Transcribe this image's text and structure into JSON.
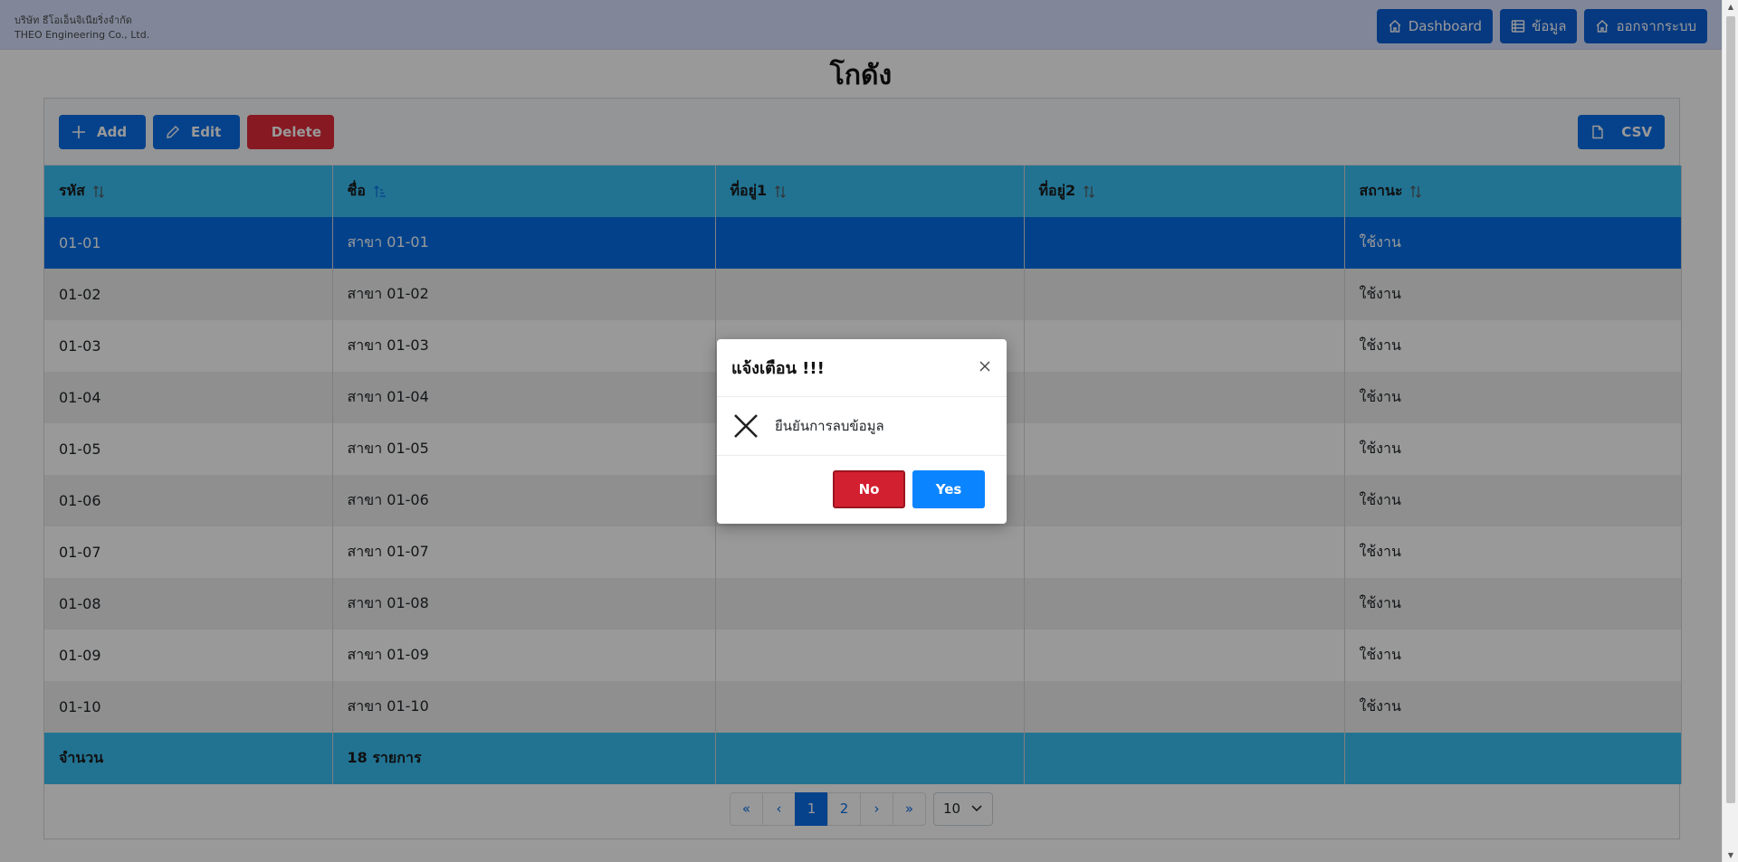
{
  "header": {
    "company_th": "บริษัท ธีโอเอ็นจิเนียริ่งจำกัด",
    "company_en": "THEO Engineering Co., Ltd.",
    "nav": [
      {
        "label": "Dashboard",
        "icon": "home-icon"
      },
      {
        "label": "ข้อมูล",
        "icon": "list-icon"
      },
      {
        "label": "ออกจากระบบ",
        "icon": "home-icon"
      }
    ]
  },
  "page": {
    "title": "โกดัง"
  },
  "toolbar": {
    "add_label": "Add",
    "edit_label": "Edit",
    "delete_label": "Delete",
    "csv_label": "CSV"
  },
  "table": {
    "columns": [
      "รหัส",
      "ชื่อ",
      "ที่อยู่1",
      "ที่อยู่2",
      "สถานะ"
    ],
    "rows": [
      {
        "code": "01-01",
        "name": "สาขา 01-01",
        "addr1": "",
        "addr2": "",
        "status": "ใช้งาน"
      },
      {
        "code": "01-02",
        "name": "สาขา 01-02",
        "addr1": "",
        "addr2": "",
        "status": "ใช้งาน"
      },
      {
        "code": "01-03",
        "name": "สาขา 01-03",
        "addr1": "",
        "addr2": "",
        "status": "ใช้งาน"
      },
      {
        "code": "01-04",
        "name": "สาขา 01-04",
        "addr1": "",
        "addr2": "",
        "status": "ใช้งาน"
      },
      {
        "code": "01-05",
        "name": "สาขา 01-05",
        "addr1": "",
        "addr2": "",
        "status": "ใช้งาน"
      },
      {
        "code": "01-06",
        "name": "สาขา 01-06",
        "addr1": "",
        "addr2": "",
        "status": "ใช้งาน"
      },
      {
        "code": "01-07",
        "name": "สาขา 01-07",
        "addr1": "",
        "addr2": "",
        "status": "ใช้งาน"
      },
      {
        "code": "01-08",
        "name": "สาขา 01-08",
        "addr1": "",
        "addr2": "",
        "status": "ใช้งาน"
      },
      {
        "code": "01-09",
        "name": "สาขา 01-09",
        "addr1": "",
        "addr2": "",
        "status": "ใช้งาน"
      },
      {
        "code": "01-10",
        "name": "สาขา 01-10",
        "addr1": "",
        "addr2": "",
        "status": "ใช้งาน"
      }
    ],
    "footer": {
      "label": "จำนวน",
      "count": "18 รายการ"
    }
  },
  "paginator": {
    "first": "«",
    "prev": "‹",
    "pages": [
      "1",
      "2"
    ],
    "next": "›",
    "last": "»",
    "page_size": "10"
  },
  "dialog": {
    "title": "แจ้งเตือน !!!",
    "message": "ยืนยันการลบข้อมูล",
    "no_label": "No",
    "yes_label": "Yes"
  }
}
